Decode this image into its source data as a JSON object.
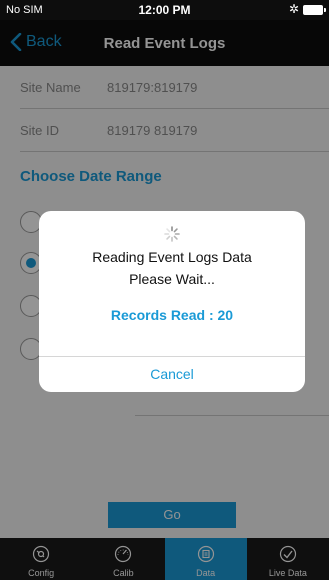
{
  "status_bar": {
    "carrier": "No SIM",
    "time": "12:00 PM",
    "bluetooth": "✲"
  },
  "nav": {
    "back_label": "Back",
    "title": "Read Event Logs"
  },
  "form": {
    "site_name_label": "Site Name",
    "site_name_value": "819179:819179",
    "site_id_label": "Site ID",
    "site_id_value": "819179 819179",
    "date_range_title": "Choose Date Range",
    "date_options_selected_index": 1,
    "go_label": "Go"
  },
  "dialog": {
    "title": "Reading Event Logs Data",
    "message": "Please Wait...",
    "records": "Records Read : 20",
    "cancel_label": "Cancel"
  },
  "tabs": [
    {
      "label": "Config",
      "icon": "config-icon",
      "active": false
    },
    {
      "label": "Calib",
      "icon": "gauge-icon",
      "active": false
    },
    {
      "label": "Data",
      "icon": "data-icon",
      "active": true
    },
    {
      "label": "Live Data",
      "icon": "checkmark-icon",
      "active": false
    }
  ],
  "colors": {
    "accent": "#1a9ad6",
    "bar": "#0d0d0d",
    "tabbar": "#1b1b1b"
  }
}
